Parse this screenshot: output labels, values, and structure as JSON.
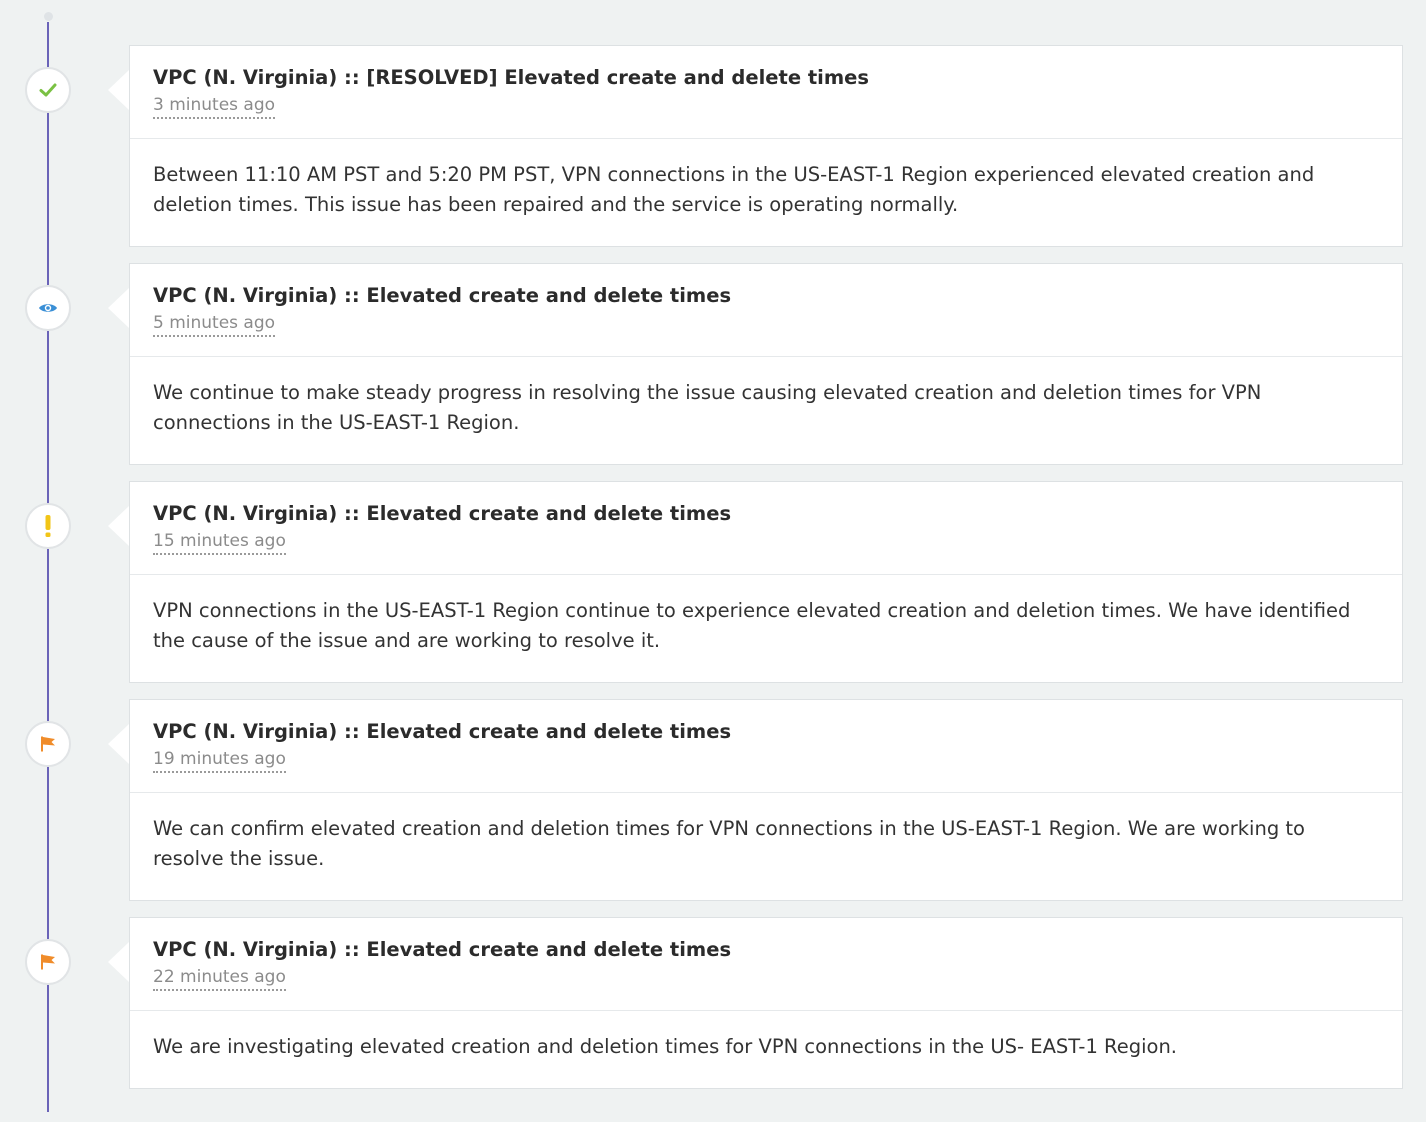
{
  "colors": {
    "timeline": "#6a63b8",
    "resolved": "#7ac143",
    "monitoring": "#3a8fd6",
    "identified": "#f2c517",
    "investigating": "#f08c2a"
  },
  "events": [
    {
      "status_icon": "check-icon",
      "title": "VPC (N. Virginia) :: [RESOLVED] Elevated create and delete times",
      "time": "3 minutes ago",
      "body": "Between 11:10 AM PST and 5:20 PM PST, VPN connections in the US-EAST-1 Region experienced elevated creation and deletion times. This issue has been repaired and the service is operating normally."
    },
    {
      "status_icon": "eye-icon",
      "title": "VPC (N. Virginia) :: Elevated create and delete times",
      "time": "5 minutes ago",
      "body": "We continue to make steady progress in resolving the issue causing elevated creation and deletion times for VPN connections in the US-EAST-1 Region."
    },
    {
      "status_icon": "exclamation-icon",
      "title": "VPC (N. Virginia) :: Elevated create and delete times",
      "time": "15 minutes ago",
      "body": "VPN connections in the US-EAST-1 Region continue to experience elevated creation and deletion times. We have identified the cause of the issue and are working to resolve it."
    },
    {
      "status_icon": "flag-icon",
      "title": "VPC (N. Virginia) :: Elevated create and delete times",
      "time": "19 minutes ago",
      "body": "We can confirm elevated creation and deletion times for VPN connections in the US-EAST-1 Region. We are working to resolve the issue."
    },
    {
      "status_icon": "flag-icon",
      "title": "VPC (N. Virginia) :: Elevated create and delete times",
      "time": "22 minutes ago",
      "body": "We are investigating elevated creation and deletion times for VPN connections in the US- EAST-1 Region."
    }
  ]
}
